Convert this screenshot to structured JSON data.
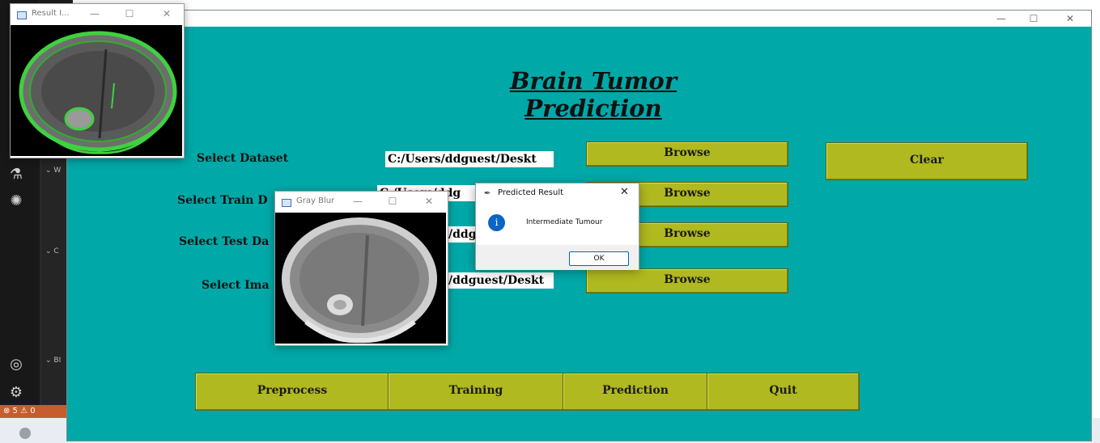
{
  "app": {
    "heading": "Brain Tumor Prediction",
    "labels": {
      "dataset": "Select Dataset",
      "train": "Select Train D",
      "test": "Select Test Da",
      "image": "Select Ima"
    },
    "entries": {
      "dataset": "C:/Users/ddguest/Deskt",
      "train": "C:/Users/ddg",
      "test": "/ddg",
      "image": "/ddguest/Deskt"
    },
    "browse_label": "Browse",
    "clear_label": "Clear",
    "bottom_buttons": [
      "Preprocess",
      "Training",
      "Prediction",
      "Quit"
    ]
  },
  "windows": {
    "result": {
      "title": "Result I..."
    },
    "gray_blur": {
      "title": "Gray Blur"
    }
  },
  "dialog": {
    "title": "Predicted Result",
    "message": "Intermediate Tumour",
    "ok_label": "OK",
    "close_glyph": "✕"
  },
  "ide": {
    "section_w": "W",
    "section_c": "C",
    "section_b": "BI",
    "status_text": "⊗ 5 ⚠ 0"
  },
  "icons": {
    "min": "—",
    "max": "☐",
    "close": "✕",
    "info": "i"
  },
  "colors": {
    "window_bg": "#00a8a8",
    "button_bg": "#b0b91f",
    "heading": "#111111"
  }
}
